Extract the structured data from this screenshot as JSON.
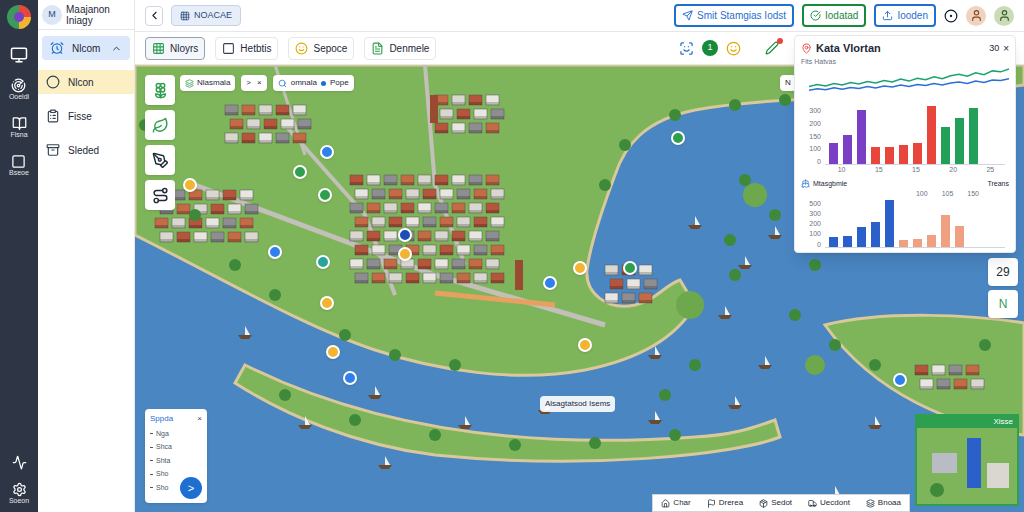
{
  "sidebar": {
    "items": [
      {
        "label": "Ooeldi"
      },
      {
        "label": "Fisna"
      },
      {
        "label": "Bseoe"
      }
    ],
    "settings": "Soeon"
  },
  "header": {
    "avatar": "M",
    "title": "Maajanon",
    "subtitle": "Iniagy"
  },
  "nav": {
    "items": [
      {
        "label": "Nlcom",
        "selected": true,
        "expanded": true,
        "highlighted": false
      },
      {
        "label": "Nlcon",
        "selected": false,
        "expanded": false,
        "highlighted": true
      },
      {
        "label": "Fisse",
        "selected": false,
        "expanded": false,
        "highlighted": false
      },
      {
        "label": "Sleded",
        "selected": false,
        "expanded": false,
        "highlighted": false
      }
    ]
  },
  "topbar": {
    "breadcrumb": "NOACAE",
    "buttons": [
      {
        "label": "Smit Stamgias Iodst",
        "color": "#1f6fd1"
      },
      {
        "label": "Iodatad",
        "color": "#178a3a"
      },
      {
        "label": "Iooden",
        "color": "#1f6fd1"
      }
    ]
  },
  "tabs": [
    {
      "label": "Nloyrs",
      "selected": true
    },
    {
      "label": "Hetbtis",
      "selected": false
    },
    {
      "label": "Sepoce",
      "selected": false
    },
    {
      "label": "Denmele",
      "selected": false
    }
  ],
  "tab_badge": "1",
  "map": {
    "toolbar": {
      "layer": "Nlasmala",
      "next": ">",
      "close": "×",
      "search": "omnala",
      "tag": "Pope",
      "end": "N"
    },
    "label": "Alsagtatsod Isems",
    "pins": [
      {
        "color": "#2f80ed"
      },
      {
        "color": "#2e9e4f"
      },
      {
        "color": "#2e9e4f"
      },
      {
        "color": "#2f80ed"
      },
      {
        "color": "#26a69a"
      },
      {
        "color": "#f2b431"
      },
      {
        "color": "#f2b431"
      },
      {
        "color": "#1b4fb8"
      },
      {
        "color": "#f2b431"
      },
      {
        "color": "#2f80ed"
      },
      {
        "color": "#f2b431"
      },
      {
        "color": "#2e9e4f"
      },
      {
        "color": "#2e9e4f"
      },
      {
        "color": "#2f80ed"
      },
      {
        "color": "#f2b431"
      },
      {
        "color": "#f2b431"
      },
      {
        "color": "#2f80ed"
      }
    ],
    "zoom": [
      "29",
      "N"
    ],
    "minimap": {
      "label": "Xisse"
    }
  },
  "legend_panel": {
    "title": "Sppda",
    "close": "×",
    "items": [
      "Nga",
      "Shca",
      "Shta",
      "Sho",
      "Sho"
    ],
    "action": ">"
  },
  "bottom_bar": {
    "items": [
      "Char",
      "Drerea",
      "Sedot",
      "Uecdont",
      "Bnoaa"
    ]
  },
  "chart_panel": {
    "title": "Kata Vlortan",
    "count": "30",
    "close": "×",
    "subtitle": "Fits Hatvas",
    "line": {
      "max": 70,
      "series": [
        {
          "color": "#2a6fdb",
          "values": [
            22,
            25,
            23,
            27,
            24,
            28,
            26,
            30,
            27,
            31,
            29,
            33,
            30,
            34,
            32,
            36,
            33,
            37,
            39,
            36,
            41,
            38,
            43,
            42,
            46
          ]
        },
        {
          "color": "#1aa36b",
          "values": [
            30,
            34,
            31,
            36,
            33,
            38,
            35,
            40,
            37,
            42,
            39,
            45,
            41,
            47,
            44,
            50,
            46,
            52,
            55,
            51,
            58,
            54,
            62,
            60,
            66
          ]
        }
      ]
    },
    "bars1": {
      "y_ticks": [
        "300",
        "200",
        "150",
        "100",
        "0"
      ],
      "x_ticks": [
        "10",
        "15",
        "15",
        "20",
        "25"
      ],
      "series": [
        {
          "color": "#7b3fc6",
          "values": [
            110,
            150,
            280
          ]
        },
        {
          "color": "#e8453c",
          "values": [
            90,
            90,
            100,
            110,
            300
          ]
        },
        {
          "color": "#22a05a",
          "values": [
            190,
            240,
            290
          ]
        }
      ]
    },
    "bars2": {
      "title": "Mtasgbmle",
      "note": "Treans",
      "top_ticks": [
        "100",
        "105",
        "150"
      ],
      "y_ticks": [
        "500",
        "300",
        "200",
        "100",
        "0"
      ],
      "series": [
        {
          "color": "#2b5fc9",
          "values": [
            100,
            110,
            200,
            260,
            480
          ]
        },
        {
          "color": "#f0a080",
          "values": [
            70,
            80,
            120,
            330,
            210
          ]
        }
      ]
    }
  }
}
